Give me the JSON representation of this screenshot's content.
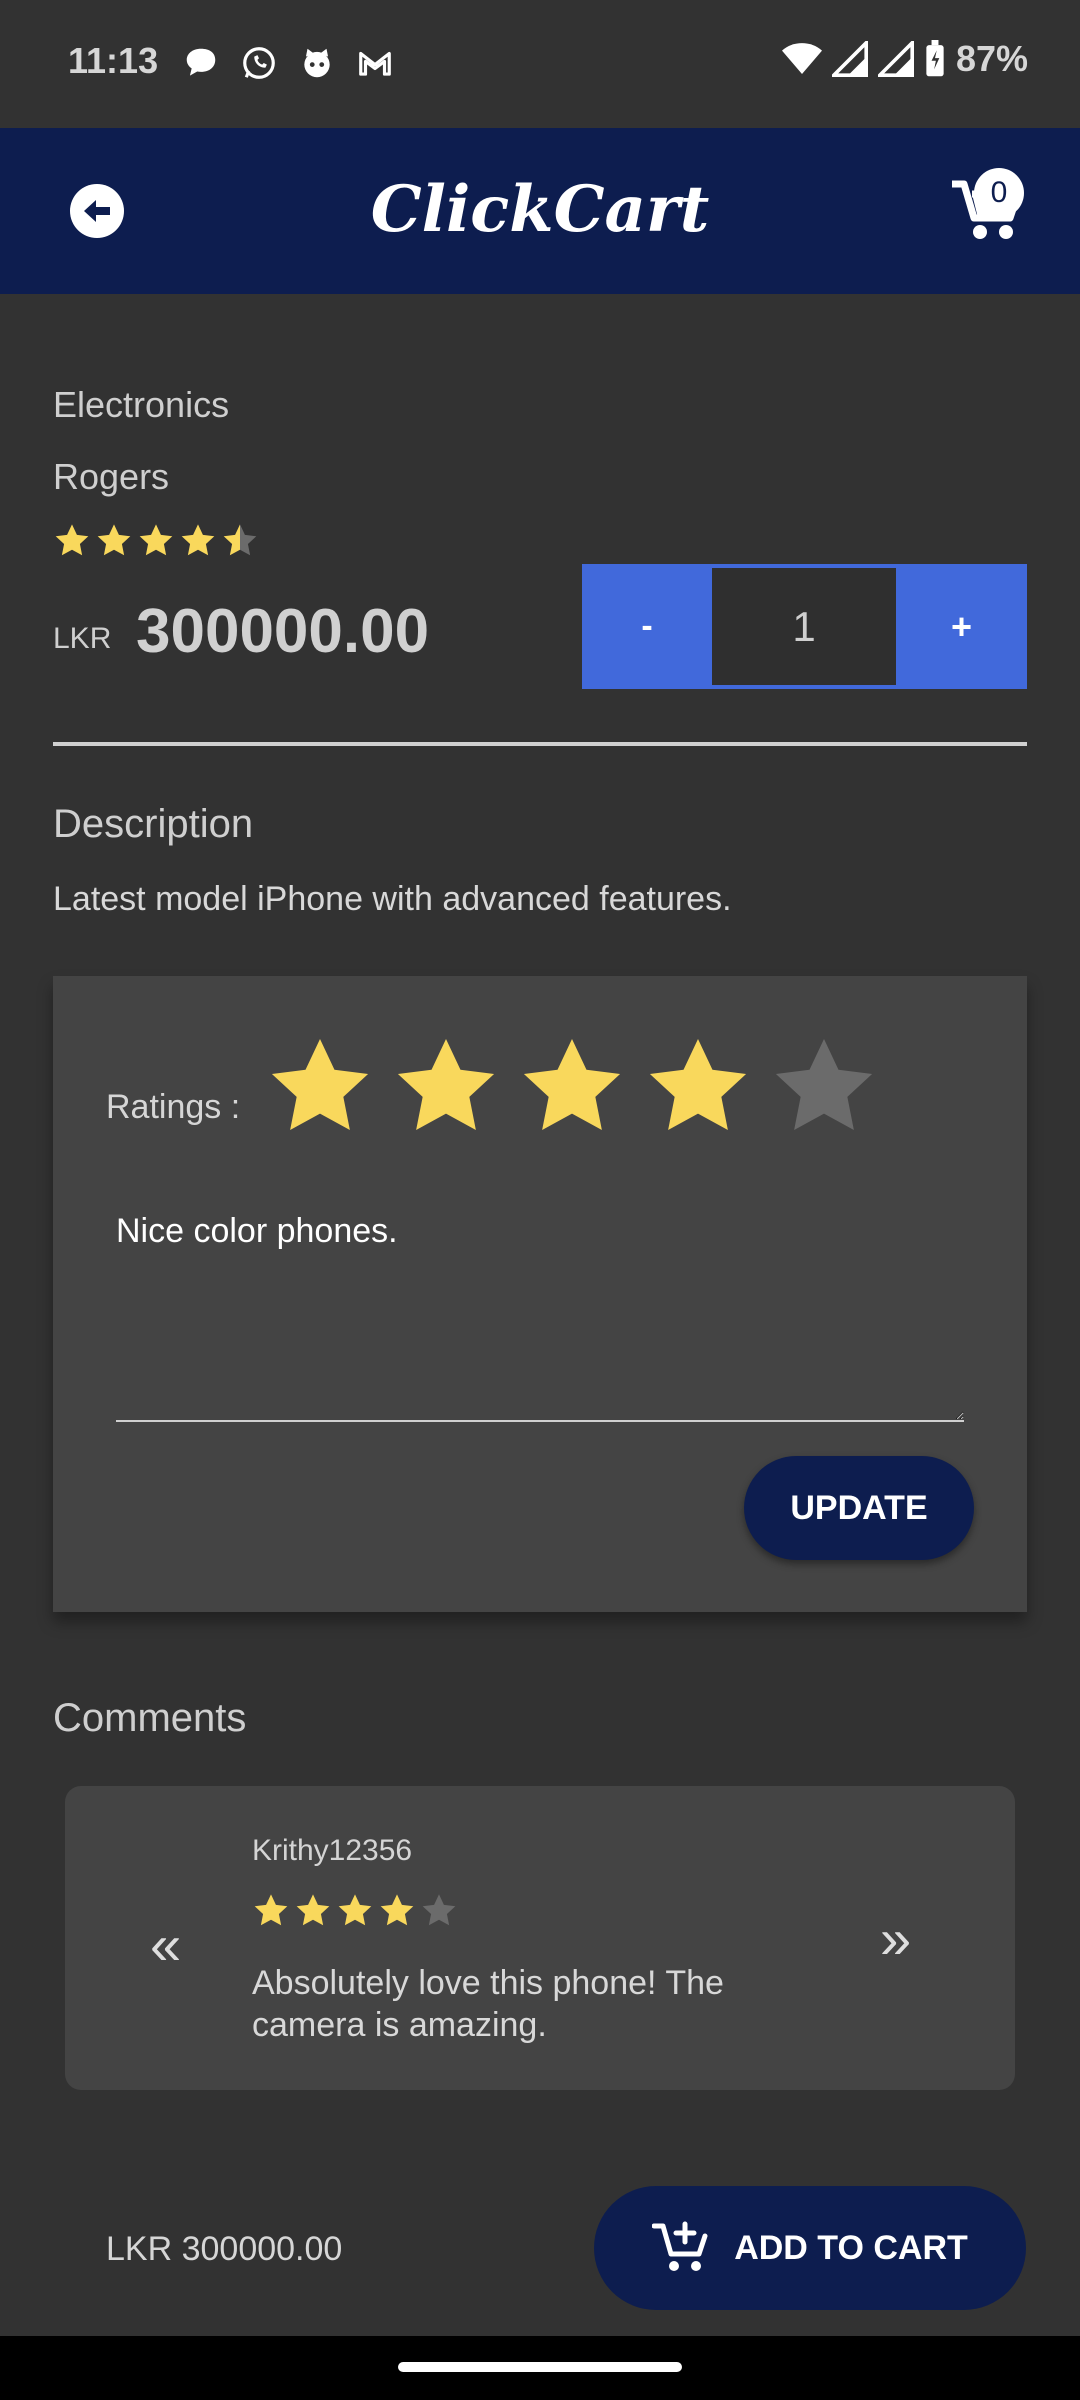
{
  "status_bar": {
    "time": "11:13",
    "battery": "87%",
    "icons": [
      "chat-bubble-icon",
      "whatsapp-icon",
      "cat-icon",
      "gmail-icon",
      "wifi-icon",
      "signal-icon",
      "signal-icon",
      "battery-icon"
    ]
  },
  "header": {
    "brand": "ClickCart",
    "cart_count": "0",
    "back_icon": "arrow-left-icon",
    "cart_icon": "cart-icon",
    "color": "#0d1d4f"
  },
  "product": {
    "category": "Electronics",
    "brand": "Rogers",
    "rating": 4.5,
    "currency": "LKR",
    "price": "300000.00",
    "quantity": "1",
    "minus_label": "-",
    "plus_label": "+"
  },
  "description": {
    "heading": "Description",
    "text": "Latest model iPhone with advanced features."
  },
  "review_form": {
    "label": "Ratings :",
    "rating": 4,
    "max_rating": 5,
    "text": "Nice color phones.",
    "button": "UPDATE"
  },
  "comments": {
    "heading": "Comments",
    "prev_icon": "double-chevron-left-icon",
    "next_icon": "double-chevron-right-icon",
    "current": {
      "user": "Krithy12356",
      "rating": 4,
      "text": "Absolutely love this phone! The camera is amazing."
    }
  },
  "footer": {
    "total": "LKR 300000.00",
    "add_button": "ADD TO CART"
  },
  "colors": {
    "accent_blue": "#4169db",
    "star_gold": "#f9d85c",
    "star_empty": "#6b6b6b"
  }
}
